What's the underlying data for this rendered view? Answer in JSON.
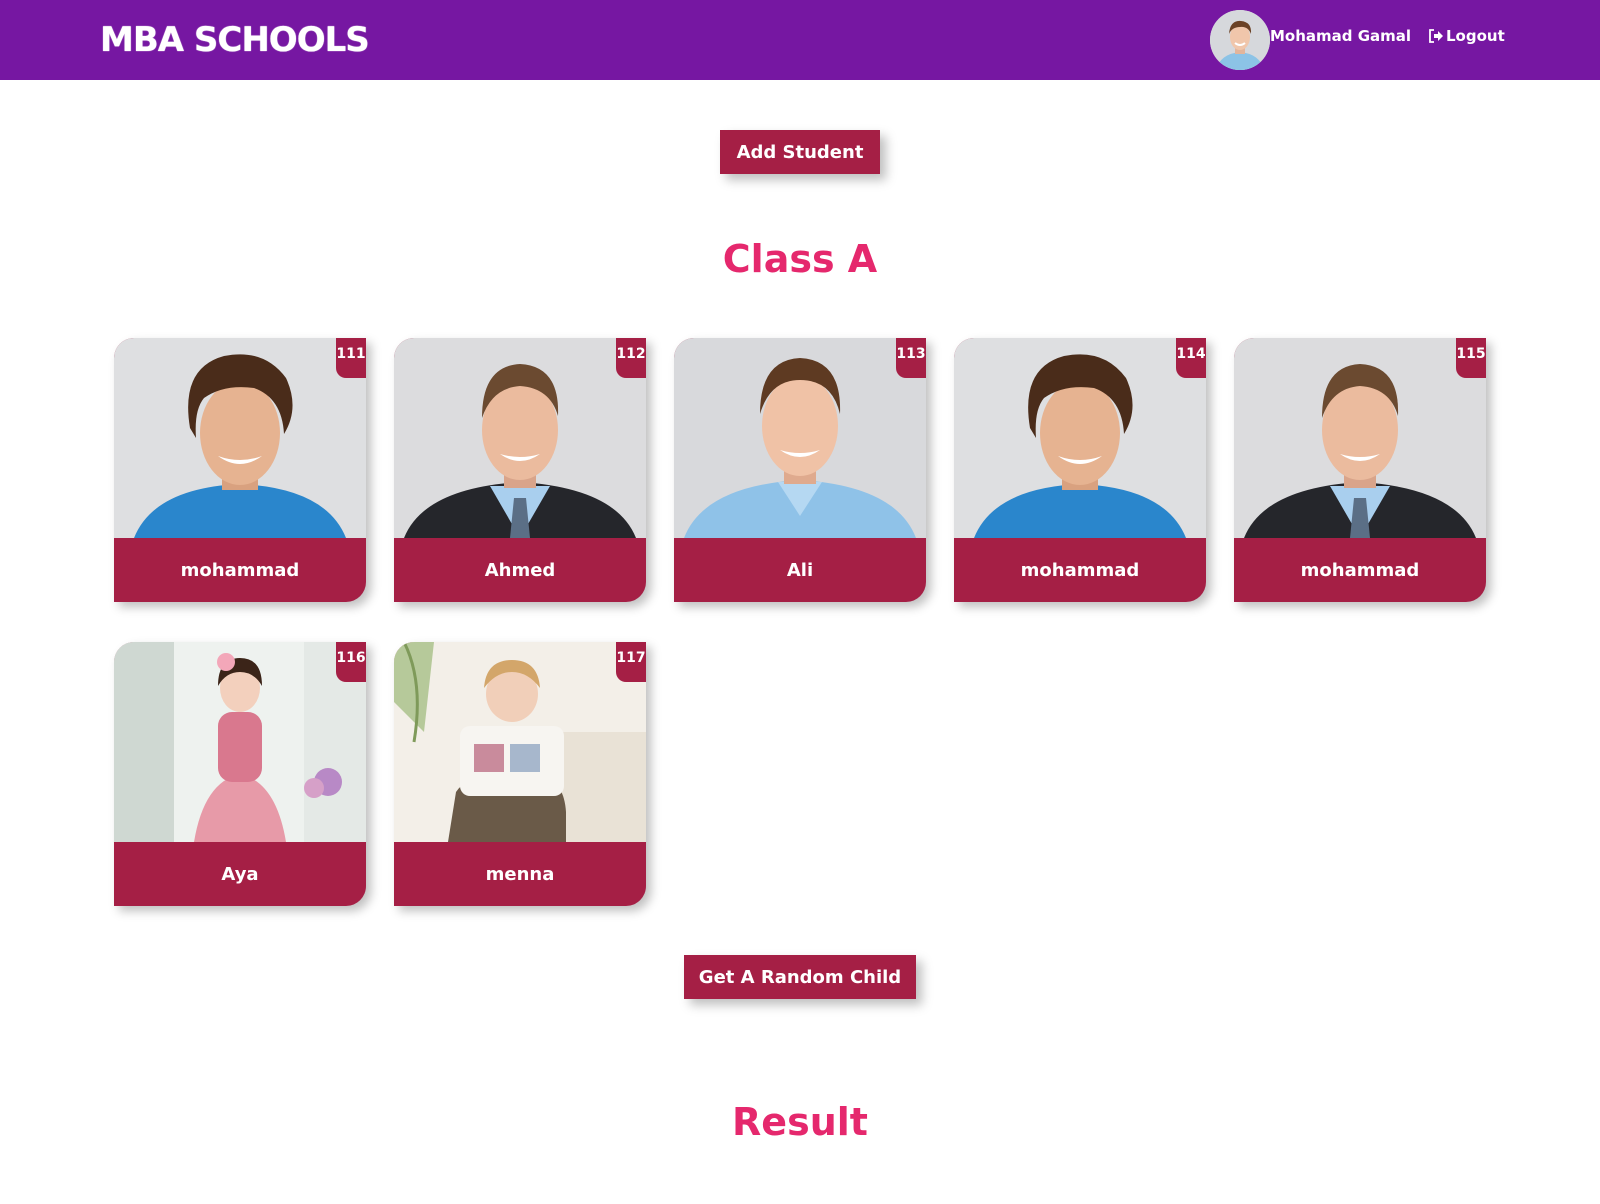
{
  "navbar": {
    "brand": "MBA SCHOOLS",
    "user_name": "Mohamad Gamal",
    "logout_label": "Logout",
    "logout_icon": "sign-out-icon"
  },
  "actions": {
    "add_student_label": "Add Student",
    "random_child_label": "Get A Random Child"
  },
  "class_section": {
    "title": "Class A",
    "students": [
      {
        "id": "111",
        "name": "mohammad",
        "photo": "curly-hair-man-blue-tshirt"
      },
      {
        "id": "112",
        "name": "Ahmed",
        "photo": "man-in-suit"
      },
      {
        "id": "113",
        "name": "Ali",
        "photo": "man-blue-shirt"
      },
      {
        "id": "114",
        "name": "mohammad",
        "photo": "curly-hair-man-blue-tshirt"
      },
      {
        "id": "115",
        "name": "mohammad",
        "photo": "man-in-suit"
      },
      {
        "id": "116",
        "name": "Aya",
        "photo": "girl-pink-dress"
      },
      {
        "id": "117",
        "name": "menna",
        "photo": "toddler-happy-baby"
      }
    ]
  },
  "result_section": {
    "title": "Result"
  },
  "colors": {
    "navbar": "#7617a2",
    "accent": "#a51f45",
    "heading": "#e5286d"
  }
}
